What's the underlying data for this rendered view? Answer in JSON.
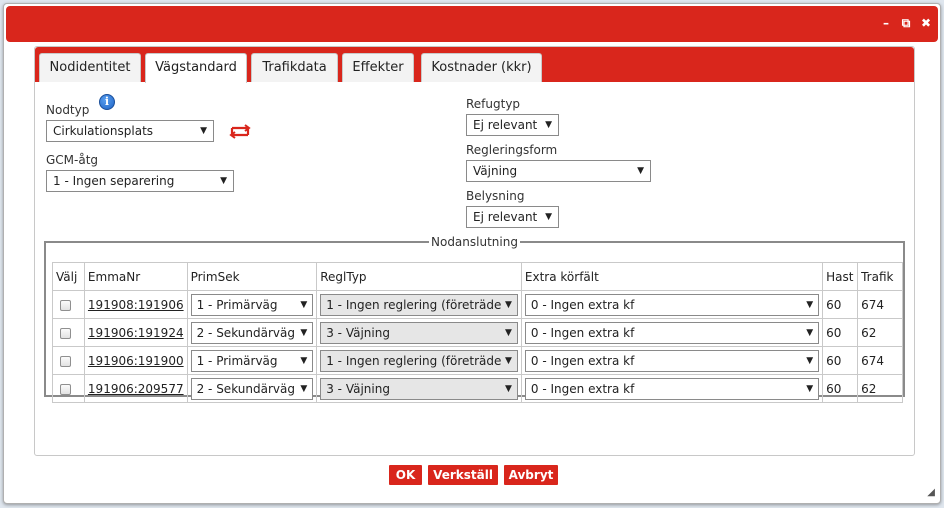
{
  "window": {
    "controls": {
      "minimize": "–",
      "popout": "⧉",
      "close": "✖"
    }
  },
  "tabs": [
    {
      "label": "Nodidentitet",
      "active": false
    },
    {
      "label": "Vägstandard",
      "active": true
    },
    {
      "label": "Trafikdata",
      "active": false
    },
    {
      "label": "Effekter",
      "active": false
    },
    {
      "label": "Kostnader (kkr)",
      "active": false
    }
  ],
  "form": {
    "nodtyp": {
      "label": "Nodtyp",
      "value": "Cirkulationsplats"
    },
    "gcm": {
      "label": "GCM-åtg",
      "value": "1 - Ingen separering"
    },
    "refugtyp": {
      "label": "Refugtyp",
      "value": "Ej relevant"
    },
    "regleringsform": {
      "label": "Regleringsform",
      "value": "Väjning"
    },
    "belysning": {
      "label": "Belysning",
      "value": "Ej relevant"
    }
  },
  "nodanslutning": {
    "legend": "Nodanslutning",
    "columns": [
      "Välj",
      "EmmaNr",
      "PrimSek",
      "ReglTyp",
      "Extra körfält",
      "Hast",
      "Trafik"
    ],
    "rows": [
      {
        "emmanr": "191908:191906",
        "primsek": "1 - Primärväg",
        "regltyp": "1 - Ingen reglering (företräde",
        "extra": "0 - Ingen extra kf",
        "hast": "60",
        "trafik": "674"
      },
      {
        "emmanr": "191906:191924",
        "primsek": "2 - Sekundärväg",
        "regltyp": "3 - Väjning",
        "extra": "0 - Ingen extra kf",
        "hast": "60",
        "trafik": "62"
      },
      {
        "emmanr": "191906:191900",
        "primsek": "1 - Primärväg",
        "regltyp": "1 - Ingen reglering (företräde",
        "extra": "0 - Ingen extra kf",
        "hast": "60",
        "trafik": "674"
      },
      {
        "emmanr": "191906:209577",
        "primsek": "2 - Sekundärväg",
        "regltyp": "3 - Väjning",
        "extra": "0 - Ingen extra kf",
        "hast": "60",
        "trafik": "62"
      }
    ]
  },
  "buttons": {
    "ok": "OK",
    "apply": "Verkställ",
    "cancel": "Avbryt"
  },
  "icons": {
    "info": "i",
    "dropdown": "▼",
    "resize": "◢"
  },
  "colors": {
    "accent": "#d9261c",
    "info": "#1d62c4"
  }
}
